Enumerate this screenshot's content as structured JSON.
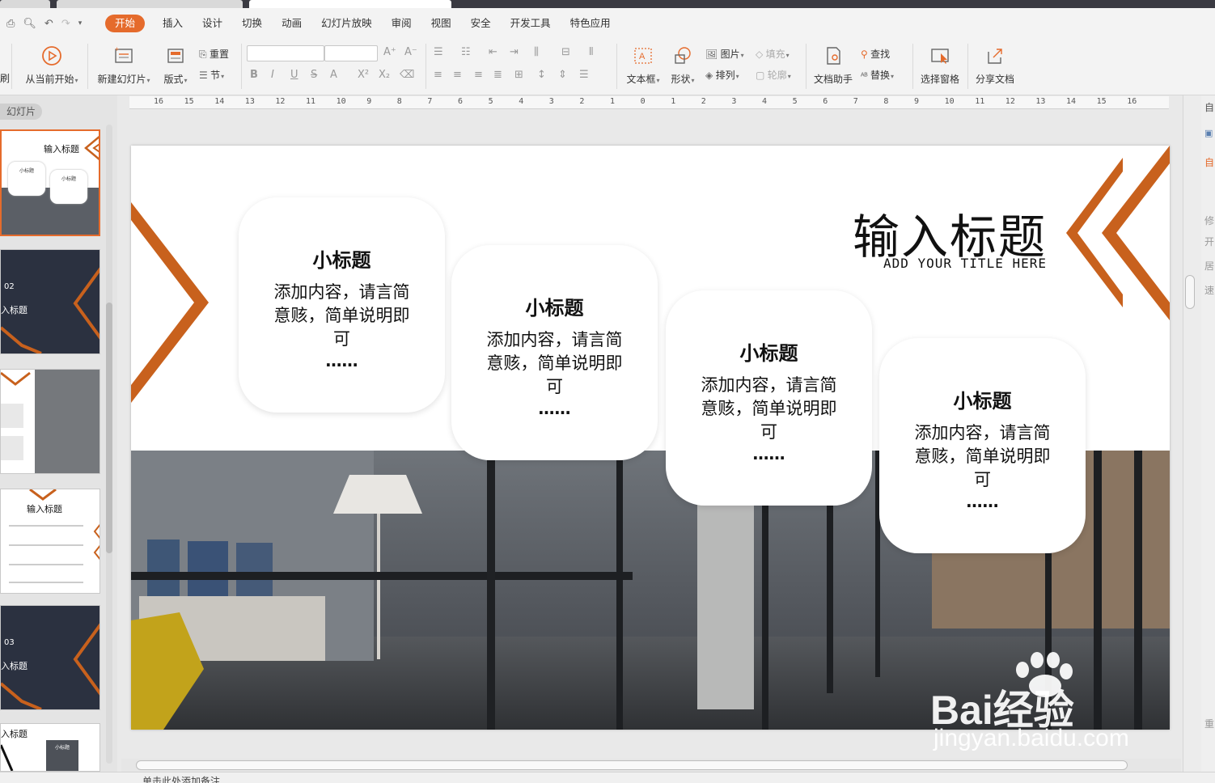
{
  "menu": {
    "items": [
      "开始",
      "插入",
      "设计",
      "切换",
      "动画",
      "幻灯片放映",
      "审阅",
      "视图",
      "安全",
      "开发工具",
      "特色应用"
    ],
    "active": "开始"
  },
  "ribbon": {
    "left_cut": "刷",
    "play_from_current": "从当前开始",
    "new_slide": "新建幻灯片",
    "layout": "版式",
    "reset": "重置",
    "section": "节",
    "textbox": "文本框",
    "shape": "形状",
    "picture": "图片",
    "arrange": "排列",
    "fill": "填充",
    "outline": "轮廓",
    "doc_helper": "文档助手",
    "find": "查找",
    "replace": "替换",
    "select_pane": "选择窗格",
    "share_doc": "分享文档"
  },
  "left_pane": {
    "label": "幻灯片",
    "thumbs": [
      {
        "title": "输入标题",
        "sub": "小标题"
      },
      {
        "num": "02",
        "title": "入标题"
      },
      {},
      {
        "title": "输入标题"
      },
      {
        "num": "03",
        "title": "入标题"
      },
      {
        "title": "入标题",
        "sub": "小标题"
      }
    ]
  },
  "ruler": [
    "16",
    "15",
    "14",
    "13",
    "12",
    "11",
    "10",
    "9",
    "8",
    "7",
    "6",
    "5",
    "4",
    "3",
    "2",
    "1",
    "0",
    "1",
    "2",
    "3",
    "4",
    "5",
    "6",
    "7",
    "8",
    "9",
    "10",
    "11",
    "12",
    "13",
    "14",
    "15",
    "16"
  ],
  "slide": {
    "title": "输入标题",
    "subtitle": "ADD YOUR TITLE HERE",
    "cards": [
      {
        "heading": "小标题",
        "body": "添加内容，请言简意赅，简单说明即可",
        "dots": "……"
      },
      {
        "heading": "小标题",
        "body": "添加内容，请言简意赅，简单说明即可",
        "dots": "……"
      },
      {
        "heading": "小标题",
        "body": "添加内容，请言简意赅，简单说明即可",
        "dots": "……"
      },
      {
        "heading": "小标题",
        "body": "添加内容，请言简意赅，简单说明即可",
        "dots": "……"
      }
    ],
    "accent": "#c8611d"
  },
  "right_pane": {
    "labels": [
      "自",
      "自",
      "修",
      "开",
      "居",
      "速",
      "重"
    ]
  },
  "status": {
    "notes_hint": "单击此处添加备注"
  },
  "watermark": {
    "brand": "Bai经验",
    "url": "jingyan.baidu.com"
  }
}
